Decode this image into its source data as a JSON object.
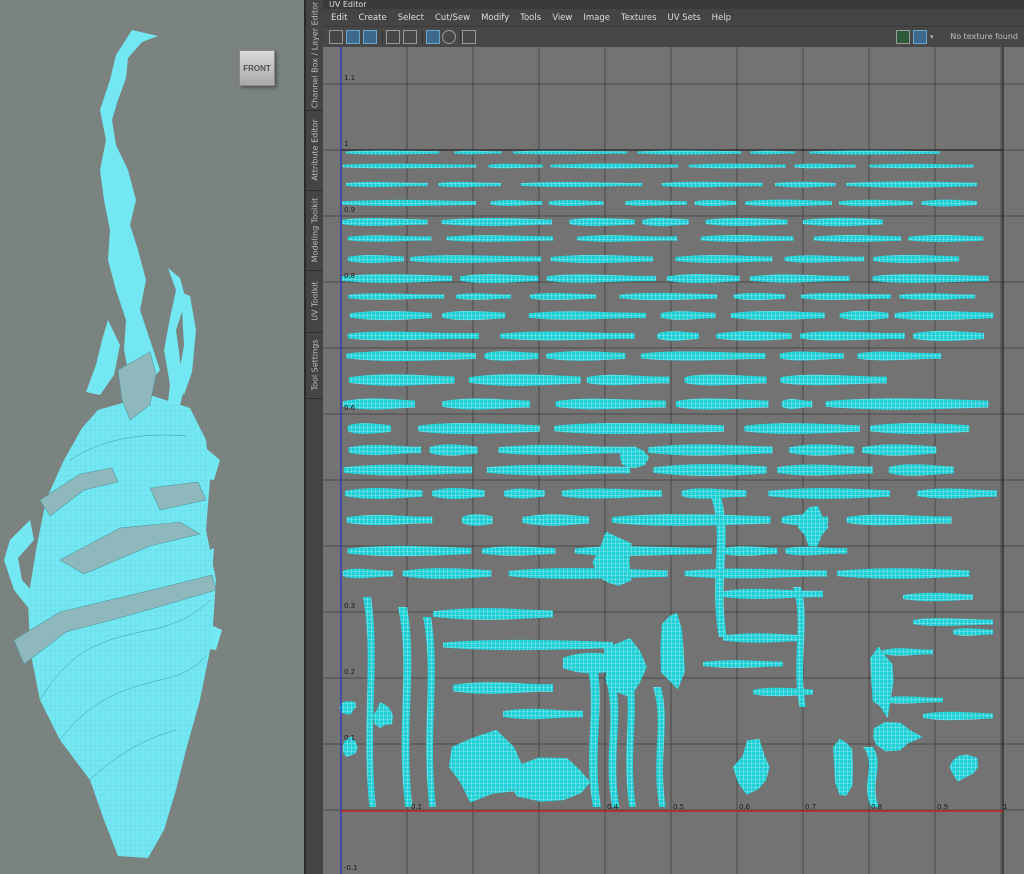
{
  "viewport": {
    "camera_label": "FRONT"
  },
  "side_tabs": [
    "Channel Box / Layer Editor",
    "Attribute Editor",
    "Modeling Toolkit",
    "UV Toolkit",
    "Tool Settings"
  ],
  "uv_editor": {
    "title": "UV Editor",
    "menu": [
      "Edit",
      "Create",
      "Select",
      "Cut/Sew",
      "Modify",
      "Tools",
      "View",
      "Image",
      "Textures",
      "UV Sets",
      "Help"
    ],
    "texture_status": "No texture found",
    "v_ticks": [
      "1.1",
      "1",
      "0.9",
      "0.8",
      "0.6",
      "0.3",
      "0.2",
      "0.1",
      "-0.1"
    ],
    "u_ticks": [
      "0.1",
      "0.4",
      "0.5",
      "0.6",
      "0.7",
      "0.8",
      "0.9",
      "1"
    ],
    "colors": {
      "uv_shell": "#1fd0d6",
      "mesh": "#74e8f2",
      "canvas": "#737373",
      "viewport": "#7a8380"
    }
  }
}
